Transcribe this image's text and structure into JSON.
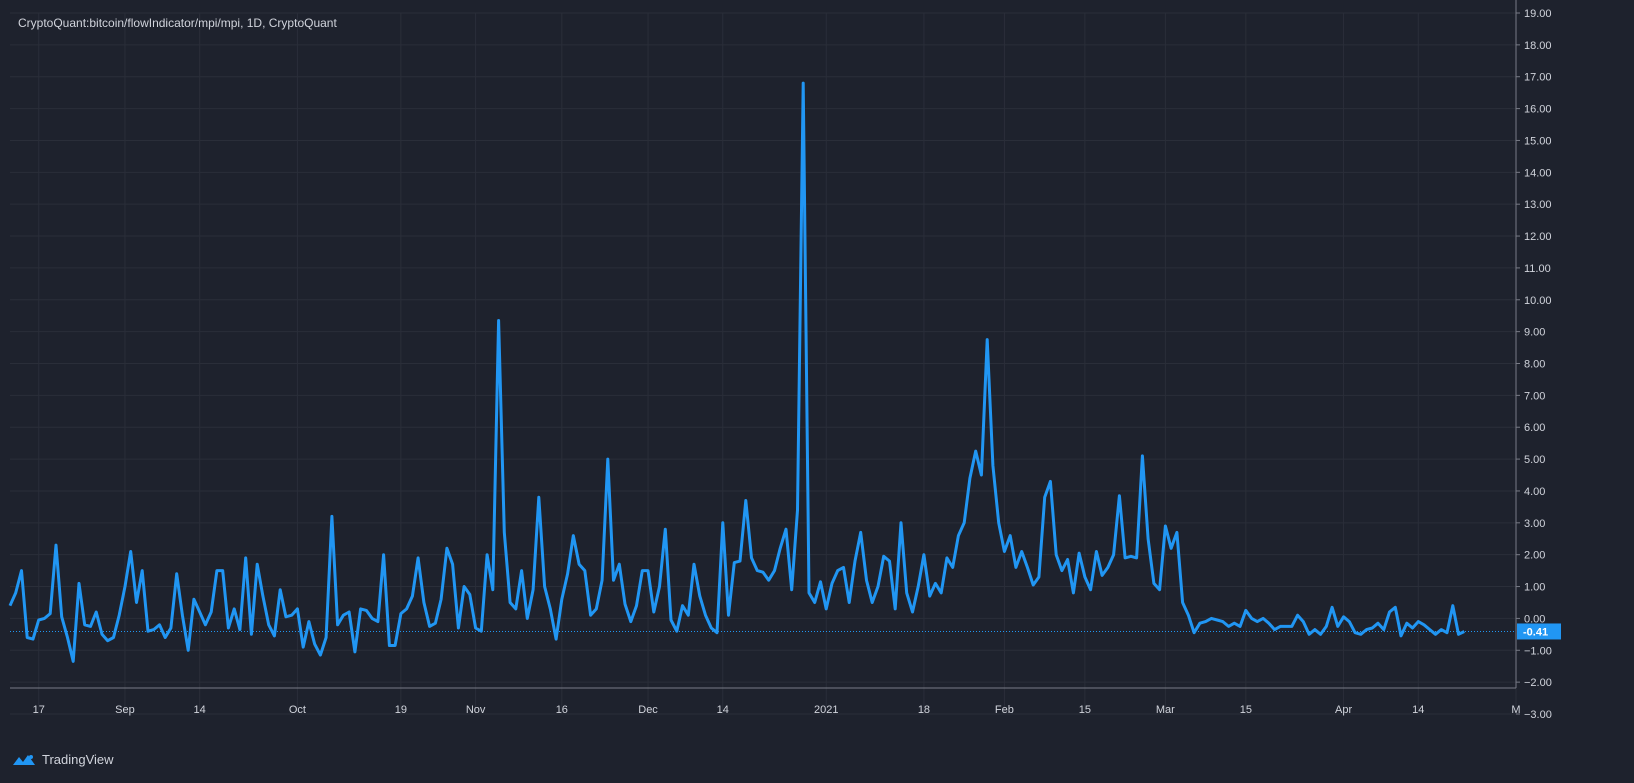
{
  "header": {
    "title": "CryptoQuant:bitcoin/flowIndicator/mpi/mpi, 1D, CryptoQuant"
  },
  "footer": {
    "brand": "TradingView"
  },
  "colors": {
    "background": "#1e222d",
    "grid": "#2a2e39",
    "line": "#2196f3",
    "price_label_bg": "#2196f3",
    "text": "#d1d4dc"
  },
  "chart_data": {
    "type": "line",
    "title": "CryptoQuant:bitcoin/flowIndicator/mpi/mpi, 1D, CryptoQuant",
    "ylim": [
      -3,
      19
    ],
    "grid": true,
    "y_ticks": [
      -3,
      -2,
      -1,
      0,
      1,
      2,
      3,
      4,
      5,
      6,
      7,
      8,
      9,
      10,
      11,
      12,
      13,
      14,
      15,
      16,
      17,
      18,
      19
    ],
    "y_tick_labels": [
      "−3.00",
      "−2.00",
      "−1.00",
      "0.00",
      "1.00",
      "2.00",
      "3.00",
      "4.00",
      "5.00",
      "6.00",
      "7.00",
      "8.00",
      "9.00",
      "10.00",
      "11.00",
      "12.00",
      "13.00",
      "14.00",
      "15.00",
      "16.00",
      "17.00",
      "18.00",
      "19.00"
    ],
    "x_ticks": [
      {
        "label": "17",
        "x": "2020-08-17"
      },
      {
        "label": "Sep",
        "x": "2020-09-01"
      },
      {
        "label": "14",
        "x": "2020-09-14"
      },
      {
        "label": "Oct",
        "x": "2020-10-01"
      },
      {
        "label": "19",
        "x": "2020-10-19"
      },
      {
        "label": "Nov",
        "x": "2020-11-01"
      },
      {
        "label": "16",
        "x": "2020-11-16"
      },
      {
        "label": "Dec",
        "x": "2020-12-01"
      },
      {
        "label": "14",
        "x": "2020-12-14"
      },
      {
        "label": "2021",
        "x": "2021-01-01"
      },
      {
        "label": "18",
        "x": "2021-01-18"
      },
      {
        "label": "Feb",
        "x": "2021-02-01"
      },
      {
        "label": "15",
        "x": "2021-02-15"
      },
      {
        "label": "Mar",
        "x": "2021-03-01"
      },
      {
        "label": "15",
        "x": "2021-03-15"
      },
      {
        "label": "Apr",
        "x": "2021-04-01"
      },
      {
        "label": "14",
        "x": "2021-04-14"
      },
      {
        "label": "M",
        "x": "2021-05-01"
      }
    ],
    "x_start": "2020-08-12",
    "x_end": "2021-05-01",
    "last_value": -0.41,
    "last_value_label": "-0.41",
    "series": [
      {
        "values": [
          0.4,
          0.8,
          1.5,
          -0.6,
          -0.65,
          -0.05,
          0.0,
          0.15,
          2.3,
          0.05,
          -0.6,
          -1.35,
          1.1,
          -0.2,
          -0.25,
          0.2,
          -0.5,
          -0.7,
          -0.6,
          0.1,
          1.0,
          2.1,
          0.5,
          1.5,
          -0.4,
          -0.35,
          -0.2,
          -0.6,
          -0.3,
          1.4,
          0.1,
          -1.0,
          0.6,
          0.2,
          -0.2,
          0.2,
          1.5,
          1.5,
          -0.3,
          0.3,
          -0.35,
          1.9,
          -0.5,
          1.7,
          0.7,
          -0.2,
          -0.55,
          0.9,
          0.05,
          0.1,
          0.3,
          -0.9,
          -0.1,
          -0.8,
          -1.15,
          -0.6,
          3.2,
          -0.2,
          0.1,
          0.2,
          -1.05,
          0.3,
          0.25,
          0.0,
          -0.1,
          2.0,
          -0.85,
          -0.85,
          0.15,
          0.3,
          0.7,
          1.9,
          0.5,
          -0.25,
          -0.15,
          0.6,
          2.2,
          1.7,
          -0.3,
          1.0,
          0.75,
          -0.3,
          -0.4,
          2.0,
          0.9,
          9.35,
          2.7,
          0.5,
          0.3,
          1.5,
          0.0,
          0.9,
          3.8,
          1.0,
          0.3,
          -0.65,
          0.6,
          1.4,
          2.6,
          1.7,
          1.5,
          0.1,
          0.3,
          1.2,
          5.0,
          1.2,
          1.7,
          0.45,
          -0.1,
          0.4,
          1.5,
          1.5,
          0.2,
          1.0,
          2.8,
          -0.05,
          -0.4,
          0.4,
          0.1,
          1.7,
          0.7,
          0.1,
          -0.3,
          -0.45,
          3.0,
          0.1,
          1.75,
          1.8,
          3.7,
          1.9,
          1.5,
          1.45,
          1.2,
          1.5,
          2.2,
          2.8,
          0.9,
          3.4,
          16.8,
          0.8,
          0.5,
          1.15,
          0.3,
          1.1,
          1.5,
          1.6,
          0.5,
          1.8,
          2.7,
          1.2,
          0.5,
          1.0,
          1.95,
          1.8,
          0.3,
          3.0,
          0.8,
          0.2,
          1.0,
          2.0,
          0.7,
          1.1,
          0.8,
          1.9,
          1.6,
          2.6,
          3.0,
          4.4,
          5.25,
          4.5,
          8.75,
          4.8,
          3.0,
          2.1,
          2.6,
          1.6,
          2.1,
          1.6,
          1.05,
          1.3,
          3.8,
          4.3,
          2.0,
          1.5,
          1.85,
          0.8,
          2.05,
          1.3,
          0.9,
          2.1,
          1.35,
          1.6,
          2.0,
          3.85,
          1.9,
          1.95,
          1.9,
          5.1,
          2.5,
          1.1,
          0.9,
          2.9,
          2.2,
          2.7,
          0.5,
          0.1,
          -0.45,
          -0.15,
          -0.1,
          0.0,
          -0.05,
          -0.1,
          -0.25,
          -0.15,
          -0.25,
          0.25,
          0.0,
          -0.1,
          0.0,
          -0.15,
          -0.35,
          -0.25,
          -0.25,
          -0.25,
          0.1,
          -0.1,
          -0.5,
          -0.35,
          -0.5,
          -0.25,
          0.35,
          -0.25,
          0.05,
          -0.1,
          -0.45,
          -0.5,
          -0.35,
          -0.3,
          -0.15,
          -0.35,
          0.2,
          0.35,
          -0.55,
          -0.15,
          -0.3,
          -0.1,
          -0.2,
          -0.35,
          -0.5,
          -0.35,
          -0.45,
          0.4,
          -0.5,
          -0.41
        ]
      }
    ]
  }
}
